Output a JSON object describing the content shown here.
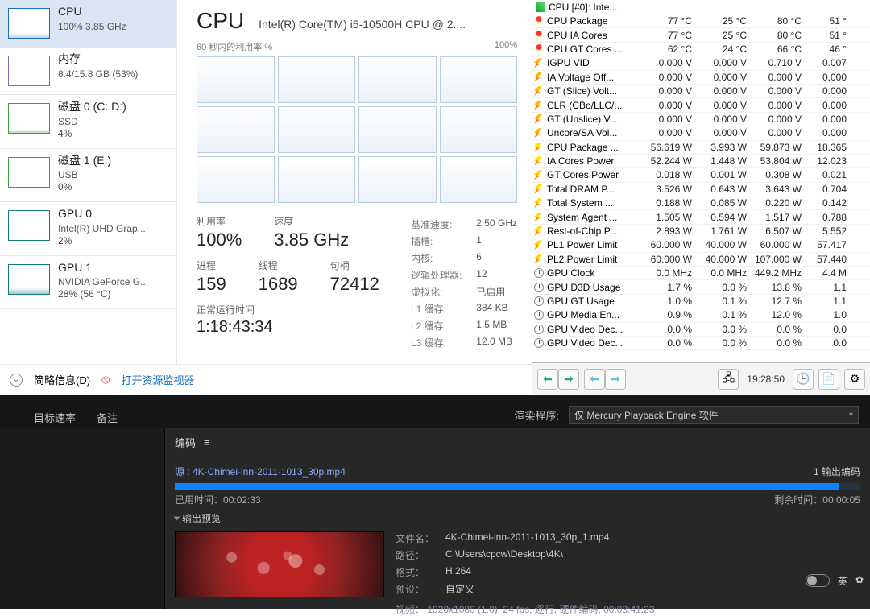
{
  "taskmgr": {
    "side": [
      {
        "title": "CPU",
        "sub": "100% 3.85 GHz",
        "sel": true,
        "cls": "cpu-g",
        "border": ""
      },
      {
        "title": "内存",
        "sub": "8.4/15.8 GB (53%)",
        "sel": false,
        "cls": "",
        "border": "mem"
      },
      {
        "title": "磁盘 0 (C: D:)",
        "sub": "SSD",
        "val": "4%",
        "sel": false,
        "cls": "disk0-g",
        "border": "disk"
      },
      {
        "title": "磁盘 1 (E:)",
        "sub": "USB",
        "val": "0%",
        "sel": false,
        "cls": "",
        "border": "disk"
      },
      {
        "title": "GPU 0",
        "sub": "Intel(R) UHD Grap...",
        "val": "2%",
        "sel": false,
        "cls": "",
        "border": "gpu"
      },
      {
        "title": "GPU 1",
        "sub": "NVIDIA GeForce G...",
        "val": "28% (56 °C)",
        "sel": false,
        "cls": "gpu1-g",
        "border": "gpu"
      }
    ],
    "main": {
      "title": "CPU",
      "model": "Intel(R) Core(TM) i5-10500H CPU @ 2....",
      "caption_left": "60 秒内的利用率 %",
      "caption_right": "100%",
      "util_label": "利用率",
      "util": "100%",
      "speed_label": "速度",
      "speed": "3.85 GHz",
      "proc_label": "进程",
      "proc": "159",
      "thr_label": "线程",
      "thr": "1689",
      "hnd_label": "句柄",
      "hnd": "72412",
      "uptime_label": "正常运行时间",
      "uptime": "1:18:43:34",
      "right": [
        [
          "基准速度:",
          "2.50 GHz"
        ],
        [
          "插槽:",
          "1"
        ],
        [
          "内核:",
          "6"
        ],
        [
          "逻辑处理器:",
          "12"
        ],
        [
          "虚拟化:",
          "已启用"
        ],
        [
          "L1 缓存:",
          "384 KB"
        ],
        [
          "L2 缓存:",
          "1.5 MB"
        ],
        [
          "L3 缓存:",
          "12.0 MB"
        ]
      ]
    },
    "footer": {
      "brief": "简略信息(D)",
      "resmon": "打开资源监视器"
    }
  },
  "hwi": {
    "header": "CPU [#0]: Inte...",
    "rows": [
      {
        "ic": "temp",
        "lbl": "CPU Package",
        "c": [
          "77 °C",
          "25 °C",
          "80 °C",
          "51 °"
        ]
      },
      {
        "ic": "temp",
        "lbl": "CPU IA Cores",
        "c": [
          "77 °C",
          "25 °C",
          "80 °C",
          "51 °"
        ]
      },
      {
        "ic": "temp",
        "lbl": "CPU GT Cores ...",
        "c": [
          "62 °C",
          "24 °C",
          "66 °C",
          "46 °"
        ]
      },
      {
        "ic": "volt",
        "lbl": "IGPU VID",
        "c": [
          "0.000 V",
          "0.000 V",
          "0.710 V",
          "0.007"
        ]
      },
      {
        "ic": "volt",
        "lbl": "IA Voltage Off...",
        "c": [
          "0.000 V",
          "0.000 V",
          "0.000 V",
          "0.000"
        ]
      },
      {
        "ic": "volt",
        "lbl": "GT (Slice) Volt...",
        "c": [
          "0.000 V",
          "0.000 V",
          "0.000 V",
          "0.000"
        ]
      },
      {
        "ic": "volt",
        "lbl": "CLR (CBo/LLC/...",
        "c": [
          "0.000 V",
          "0.000 V",
          "0.000 V",
          "0.000"
        ]
      },
      {
        "ic": "volt",
        "lbl": "GT (Unslice) V...",
        "c": [
          "0.000 V",
          "0.000 V",
          "0.000 V",
          "0.000"
        ]
      },
      {
        "ic": "volt",
        "lbl": "Uncore/SA Vol...",
        "c": [
          "0.000 V",
          "0.000 V",
          "0.000 V",
          "0.000"
        ]
      },
      {
        "ic": "watt",
        "lbl": "CPU Package ...",
        "c": [
          "56.619 W",
          "3.993 W",
          "59.873 W",
          "18.365"
        ]
      },
      {
        "ic": "watt",
        "lbl": "IA Cores Power",
        "c": [
          "52.244 W",
          "1.448 W",
          "53.804 W",
          "12.023"
        ]
      },
      {
        "ic": "watt",
        "lbl": "GT Cores Power",
        "c": [
          "0.018 W",
          "0.001 W",
          "0.308 W",
          "0.021"
        ]
      },
      {
        "ic": "watt",
        "lbl": "Total DRAM P...",
        "c": [
          "3.526 W",
          "0.643 W",
          "3.643 W",
          "0.704"
        ]
      },
      {
        "ic": "watt",
        "lbl": "Total System ...",
        "c": [
          "0.188 W",
          "0.085 W",
          "0.220 W",
          "0.142"
        ]
      },
      {
        "ic": "watt",
        "lbl": "System Agent ...",
        "c": [
          "1.505 W",
          "0.594 W",
          "1.517 W",
          "0.788"
        ]
      },
      {
        "ic": "watt",
        "lbl": "Rest-of-Chip P...",
        "c": [
          "2.893 W",
          "1.761 W",
          "6.507 W",
          "5.552"
        ]
      },
      {
        "ic": "watt",
        "lbl": "PL1 Power Limit",
        "c": [
          "60.000 W",
          "40.000 W",
          "60.000 W",
          "57.417"
        ]
      },
      {
        "ic": "watt",
        "lbl": "PL2 Power Limit",
        "c": [
          "60.000 W",
          "40.000 W",
          "107.000 W",
          "57.440"
        ]
      },
      {
        "ic": "clk",
        "lbl": "GPU Clock",
        "c": [
          "0.0 MHz",
          "0.0 MHz",
          "449.2 MHz",
          "4.4 M"
        ]
      },
      {
        "ic": "clk",
        "lbl": "GPU D3D Usage",
        "c": [
          "1.7 %",
          "0.0 %",
          "13.8 %",
          "1.1"
        ]
      },
      {
        "ic": "clk",
        "lbl": "GPU GT Usage",
        "c": [
          "1.0 %",
          "0.1 %",
          "12.7 %",
          "1.1"
        ]
      },
      {
        "ic": "clk",
        "lbl": "GPU Media En...",
        "c": [
          "0.9 %",
          "0.1 %",
          "12.0 %",
          "1.0"
        ]
      },
      {
        "ic": "clk",
        "lbl": "GPU Video Dec...",
        "c": [
          "0.0 %",
          "0.0 %",
          "0.0 %",
          "0.0"
        ]
      },
      {
        "ic": "clk",
        "lbl": "GPU Video Dec...",
        "c": [
          "0.0 %",
          "0.0 %",
          "0.0 %",
          "0.0"
        ]
      }
    ],
    "time": "19:28:50"
  },
  "strip": {
    "tabs": [
      "目标速率",
      "备注"
    ],
    "render_label": "渲染程序:",
    "render_sel": "仅 Mercury Playback Engine 软件"
  },
  "enc": {
    "title": "编码",
    "src_label": "源 : 4K-Chimei-inn-2011-1013_30p.mp4",
    "out_count": "1 输出编码",
    "elapsed_label": "已用时间：",
    "elapsed": "00:02:33",
    "remain_label": "剩余时间：",
    "remain": "00:00:05",
    "outprev": "输出预览",
    "meta": {
      "file_l": "文件名：",
      "file": "4K-Chimei-inn-2011-1013_30p_1.mp4",
      "path_l": "路径：",
      "path": "C:\\Users\\cpcw\\Desktop\\4K\\",
      "fmt_l": "格式：",
      "fmt": "H.264",
      "pre_l": "预设：",
      "pre": "自定义",
      "vid": "视频：  1920x1080 (1.0), 24 fps, 逐行, 硬件编码, 00:03:41:23"
    },
    "lang": "英"
  }
}
